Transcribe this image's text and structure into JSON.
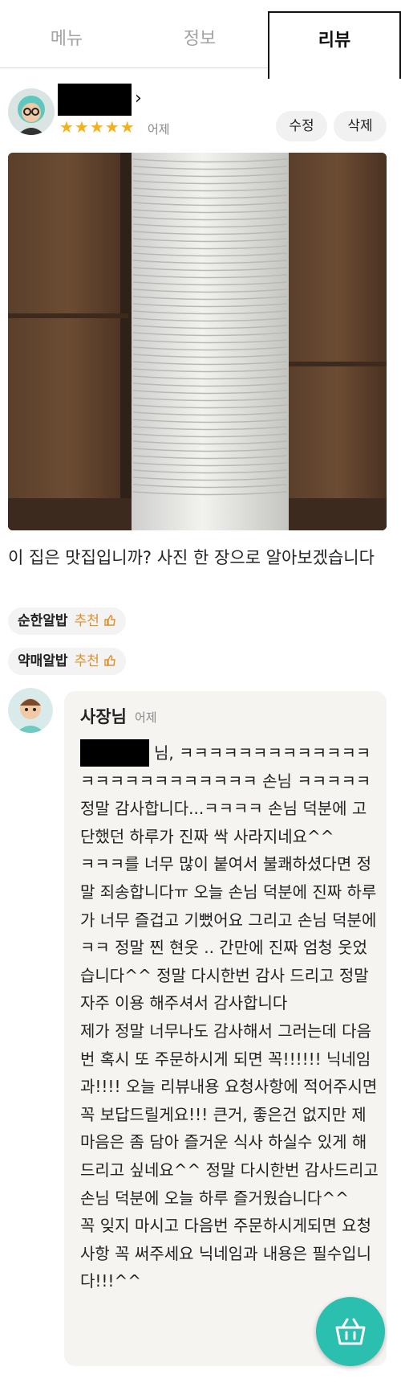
{
  "tabs": [
    {
      "label": "메뉴"
    },
    {
      "label": "정보"
    },
    {
      "label": "리뷰"
    }
  ],
  "review": {
    "stars": "★★★★★",
    "rating": 5,
    "date": "어제",
    "edit_label": "수정",
    "delete_label": "삭제",
    "text": "이 집은 맛집입니까? 사진 한 장으로 알아보겠습니다",
    "recommendations": [
      {
        "menu": "순한알밥",
        "label": "추천"
      },
      {
        "menu": "약매알밥",
        "label": "추천"
      }
    ]
  },
  "reply": {
    "author": "사장님",
    "date": "어제",
    "body": "님, ㅋㅋㅋㅋㅋㅋㅋㅋㅋㅋㅋㅋㅋㅋㅋㅋㅋㅋㅋㅋㅋㅋㅋㅋㅋ 손님 ㅋㅋㅋㅋㅋ 정말 감사합니다...ㅋㅋㅋㅋ 손님 덕분에 고단했던 하루가 진짜 싹 사라지네요^^\nㅋㅋㅋ를 너무 많이 붙여서 불쾌하셨다면 정말 죄송합니다ㅠ 오늘 손님 덕분에 진짜 하루가 너무 즐겁고 기뻤어요 그리고 손님 덕분에 ㅋㅋ 정말 찐 현웃 .. 간만에 진짜 엄청 웃었습니다^^ 정말 다시한번 감사 드리고 정말 자주 이용 해주셔서 감사합니다\n제가 정말 너무나도 감사해서 그러는데 다음번 혹시 또 주문하시게 되면 꼭!!!!!! 닉네임과!!!! 오늘 리뷰내용 요청사항에 적어주시면 꼭 보답드릴게요!!! 큰거, 좋은건 없지만 제마음은 좀 담아 즐거운 식사 하실수 있게 해드리고 싶네요^^ 정말 다시한번 감사드리고 손님 덕분에 오늘 하루 즐거웠습니다^^\n꼭 잊지 마시고 다음번 주문하시게되면 요청사항 꼭 써주세요 닉네임과 내용은 필수입니다!!!^^"
  },
  "icons": {
    "cart": "cart-icon",
    "thumbs_up": "thumbs-up-icon",
    "chevron": "chevron-right-icon"
  },
  "colors": {
    "accent": "#2bbfb0",
    "star": "#f3b21a",
    "recommend": "#e0902a"
  }
}
